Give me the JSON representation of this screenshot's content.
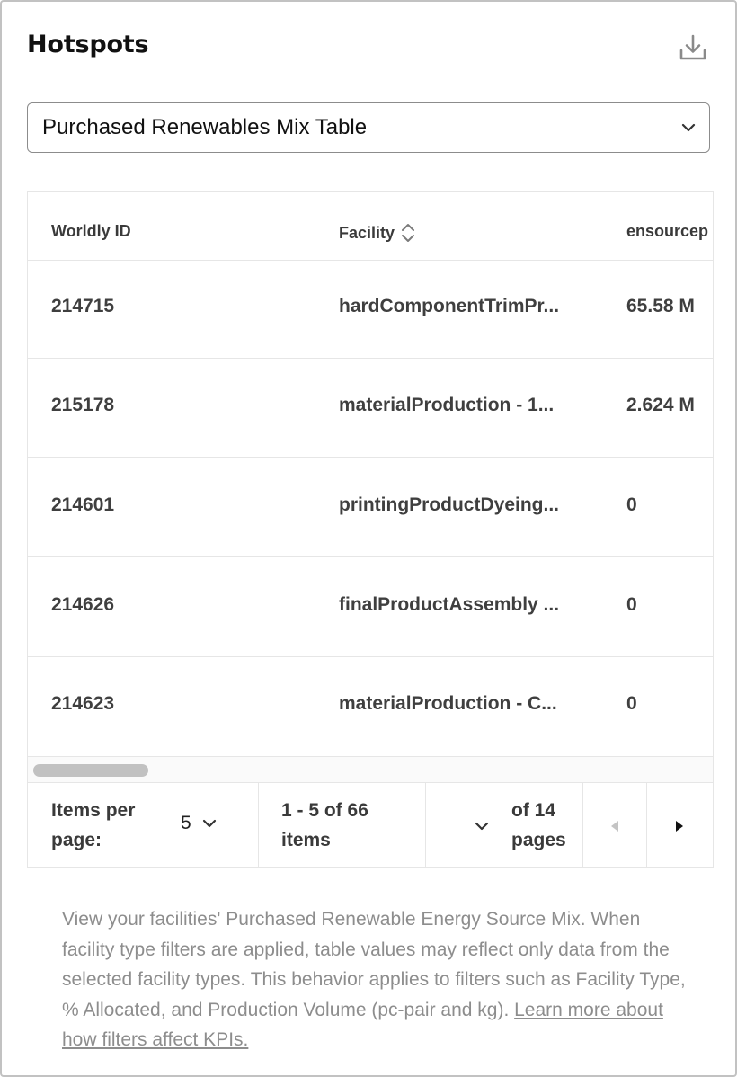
{
  "header": {
    "title": "Hotspots",
    "download_icon": "download-icon"
  },
  "selector": {
    "value": "Purchased Renewables Mix Table"
  },
  "table": {
    "columns": [
      "Worldly ID",
      "Facility",
      "ensourcep"
    ],
    "rows": [
      {
        "id": "214715",
        "facility": "hardComponentTrimPr...",
        "value": "65.58 M"
      },
      {
        "id": "215178",
        "facility": "materialProduction - 1...",
        "value": "2.624 M"
      },
      {
        "id": "214601",
        "facility": "printingProductDyeing...",
        "value": "0"
      },
      {
        "id": "214626",
        "facility": "finalProductAssembly ...",
        "value": "0"
      },
      {
        "id": "214623",
        "facility": "materialProduction - C...",
        "value": "0"
      }
    ]
  },
  "pagination": {
    "items_per_page_line1": "Items per",
    "items_per_page_line2": "page:",
    "items_per_page_value": "5",
    "range_line1": "1 - 5 of 66",
    "range_line2": "items",
    "of_pages_line1": "of 14",
    "of_pages_line2": "pages"
  },
  "footer": {
    "text": "View your facilities' Purchased Renewable Energy Source Mix. When facility type filters are applied, table values may reflect only data from the selected facility types. This behavior applies to filters such as Facility Type, % Allocated, and Production Volume (pc-pair and kg). ",
    "link": "Learn more about how filters affect KPIs."
  },
  "colors": {
    "text_dark": "#111111",
    "text_body": "#3f3f3f",
    "text_muted": "#8d8d8d",
    "border": "#e6e6e6"
  }
}
